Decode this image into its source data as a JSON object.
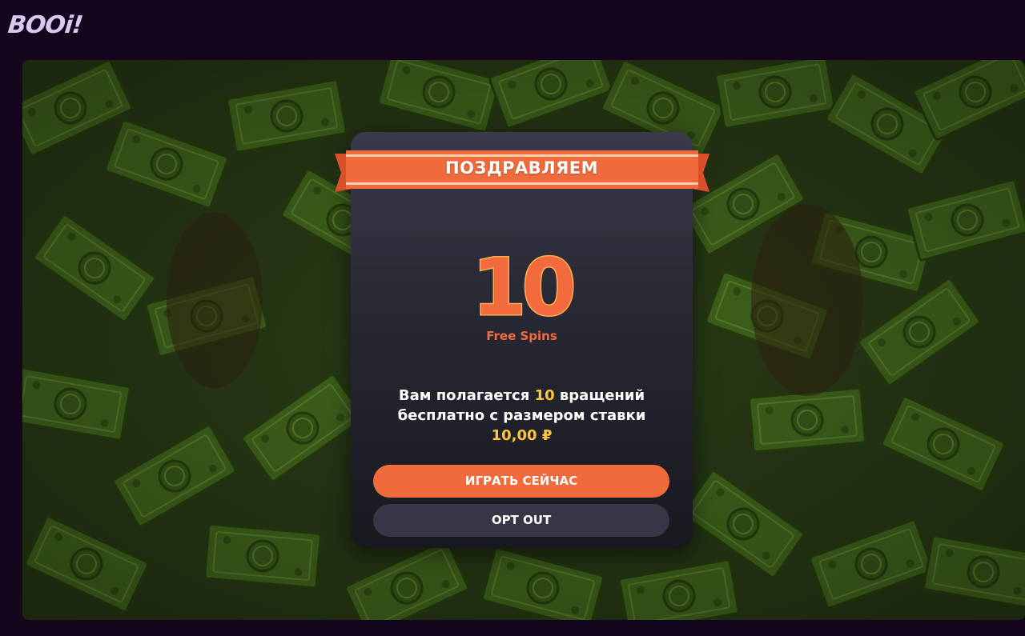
{
  "header": {
    "logo_text": "BOOi!"
  },
  "modal": {
    "ribbon_title": "ПОЗДРАВЛЯЕМ",
    "amount": "10",
    "amount_label": "Free Spins",
    "description": {
      "part1": "Вам полагается ",
      "count": "10",
      "part2": " вращений бесплатно с размером ставки",
      "bet": "10,00 ₽"
    },
    "play_button": "ИГРАТЬ СЕЙЧАС",
    "opt_out_button": "OPT OUT"
  },
  "colors": {
    "accent": "#f06a3b",
    "highlight": "#ffc53d",
    "background": "#14061d",
    "modal": "#2b2b38"
  }
}
